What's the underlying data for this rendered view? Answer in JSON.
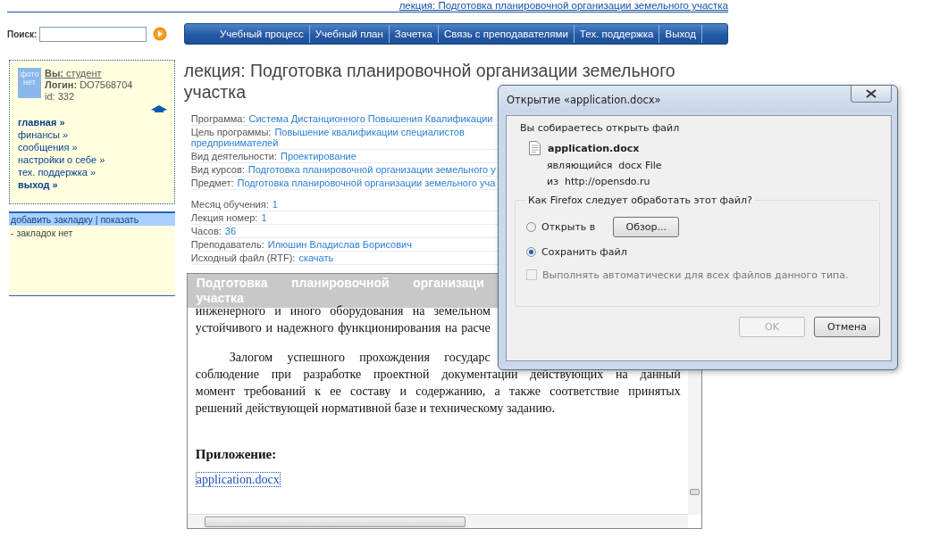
{
  "breadcrumb": {
    "text": "лекция: Подготовка планировочной организации земельного участка"
  },
  "search": {
    "label": "Поиск:"
  },
  "nav": [
    {
      "label": "Учебный процесс"
    },
    {
      "label": "Учебный план"
    },
    {
      "label": "Зачетка"
    },
    {
      "label": "Связь с преподавателями"
    },
    {
      "label": "Тех. поддержка"
    },
    {
      "label": "Выход"
    }
  ],
  "profile": {
    "photo_label": "фото нет",
    "you_label": "Вы:",
    "you_value": "студент",
    "login_label": "Логин:",
    "login_value": "DO7568704",
    "id": "id: 332"
  },
  "menu": [
    {
      "label": "главная »",
      "bold": true
    },
    {
      "label": "финансы »",
      "bold": false
    },
    {
      "label": "сообщения »",
      "bold": false
    },
    {
      "label": "настройки о себе »",
      "bold": false
    },
    {
      "label": "тех. поддержка »",
      "bold": false
    },
    {
      "label": "выход »",
      "bold": true
    }
  ],
  "bookmarks": {
    "add": "добавить закладку",
    "separator": "|",
    "show": "показать",
    "empty": "- закладок нет"
  },
  "lecture": {
    "title_lines": [
      "лекция: Подготовка планировочной организации земельного",
      "участка"
    ],
    "meta_groups": [
      [
        {
          "label": "Программа:",
          "value_lines": [
            "Система Дистанционного Повышения Квалификации"
          ]
        },
        {
          "label": "Цель программы:",
          "value_lines": [
            "Повышение квалификации специалистов",
            "предпринимателей"
          ]
        },
        {
          "label": "Вид деятельности:",
          "value_lines": [
            "Проектирование"
          ]
        },
        {
          "label": "Вид курсов:",
          "value_lines": [
            "Подготовка планировочной организации земельного у"
          ]
        },
        {
          "label": "Предмет:",
          "value_lines": [
            "Подготовка планировочной организации земельного уча"
          ]
        }
      ],
      [
        {
          "label": "Месяц обучения:",
          "value_lines": [
            "1"
          ]
        },
        {
          "label": "Лекция номер:",
          "value_lines": [
            "1"
          ]
        },
        {
          "label": "Часов:",
          "value_lines": [
            "36"
          ]
        },
        {
          "label": "Преподаватель:",
          "value_lines": [
            "Илюшин Владислав Борисович"
          ]
        },
        {
          "label": "Исходный файл (RTF):",
          "value_lines": [
            "скачать"
          ]
        }
      ]
    ]
  },
  "frame": {
    "header_lines": [
      {
        "text": "Подготовка планировочной организаци",
        "cut": true
      },
      {
        "text": "участка",
        "cut": false
      }
    ],
    "paragraphs": [
      [
        {
          "text": "инженерного и иного оборудования на земельном",
          "cut": true
        },
        {
          "text": "устойчивого и надежного функционирования на расче",
          "cut": true
        }
      ],
      [
        {
          "text": "Залогом успешного прохождения государс",
          "cut": true
        },
        {
          "text": "соблюдение при разработке проектной документации действующих на данный",
          "cut": false
        },
        {
          "text": "момент требований к ее составу и содержанию, а также соответствие принятых",
          "cut": false
        },
        {
          "text": "решений действующей нормативной базе и техническому заданию.",
          "cut": false
        }
      ]
    ],
    "attachment_label": "Приложение:",
    "attachment_link": "application.docx"
  },
  "dialog": {
    "title": "Открытие «application.docx»",
    "intro": "Вы собираетесь открыть файл",
    "file_name": "application.docx",
    "type_label": "являющийся",
    "type_value": "docx File",
    "from_label": "из",
    "from_value": "http://opensdo.ru",
    "group_label": "Как Firefox следует обработать этот файл?",
    "options": [
      {
        "label": "Открыть в",
        "selected": false,
        "button": "Обзор..."
      },
      {
        "label": "Сохранить файл",
        "selected": true
      }
    ],
    "auto": {
      "label": "Выполнять автоматически для всех файлов данного типа.",
      "checked": false,
      "disabled": true
    },
    "buttons": [
      {
        "label": "OK",
        "disabled": true
      },
      {
        "label": "Отмена",
        "disabled": false
      }
    ]
  }
}
